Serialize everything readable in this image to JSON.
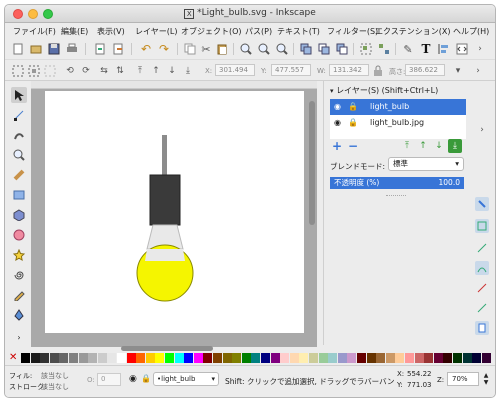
{
  "window": {
    "title": "*Light_bulb.svg - Inkscape"
  },
  "menu": [
    "ファイル(F)",
    "編集(E)",
    "表示(V)",
    "レイヤー(L)",
    "オブジェクト(O)",
    "パス(P)",
    "テキスト(T)",
    "フィルター(S)",
    "エクステンション(X)",
    "ヘルプ(H)"
  ],
  "controls": {
    "x_label": "X:",
    "x_value": "301.494",
    "y_label": "Y:",
    "y_value": "477.557",
    "w_label": "W:",
    "w_value": "131.342",
    "h_label": "高さ:",
    "h_value": "386.622"
  },
  "layers_panel": {
    "title": "レイヤー(S) (Shift+Ctrl+L)",
    "layers": [
      {
        "name": "light_bulb"
      },
      {
        "name": "light_bulb.jpg"
      }
    ],
    "blend_label": "ブレンドモード:",
    "blend_value": "標準",
    "opacity_label": "不透明度 (%)",
    "opacity_value": "100.0"
  },
  "status": {
    "fill_label": "フィル:",
    "fill_value": "該当なし",
    "stroke_label": "ストローク:",
    "stroke_value": "該当なし",
    "opacity_label": "O:",
    "opacity_value": "0",
    "layer_select": "•light_bulb",
    "message": "Shift: クリックで追加選択, ドラッグでラバーバン",
    "coord_x_label": "X:",
    "coord_x": "554.22",
    "coord_y_label": "Y:",
    "coord_y": "771.03",
    "zoom_label": "Z:",
    "zoom": "70%"
  },
  "colors": {
    "accent": "#3875d7",
    "bulb": "#f5f500",
    "socket": "#3a3a3a"
  },
  "palette": [
    "#000000",
    "#1a1a1a",
    "#333333",
    "#4d4d4d",
    "#666666",
    "#808080",
    "#999999",
    "#b3b3b3",
    "#cccccc",
    "#e6e6e6",
    "#ffffff",
    "#ff0000",
    "#ff6600",
    "#ffcc00",
    "#ffff00",
    "#00ff00",
    "#00ffff",
    "#0000ff",
    "#ff00ff",
    "#800000",
    "#804000",
    "#806600",
    "#808000",
    "#008000",
    "#008080",
    "#000080",
    "#800080",
    "#ffcccc",
    "#ffd8b0",
    "#ffeeb0",
    "#cccc99",
    "#99cc99",
    "#99cccc",
    "#9999cc",
    "#cc99cc",
    "#660000",
    "#663300",
    "#996633",
    "#cc9966",
    "#ffcc99",
    "#ff9999",
    "#cc6666",
    "#993333",
    "#660033",
    "#330000",
    "#003300",
    "#003333",
    "#000033",
    "#330033"
  ]
}
